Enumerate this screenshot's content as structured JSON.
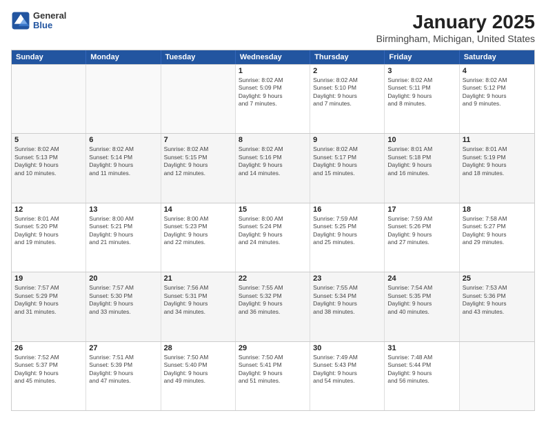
{
  "header": {
    "logo_general": "General",
    "logo_blue": "Blue",
    "month": "January 2025",
    "location": "Birmingham, Michigan, United States"
  },
  "days_of_week": [
    "Sunday",
    "Monday",
    "Tuesday",
    "Wednesday",
    "Thursday",
    "Friday",
    "Saturday"
  ],
  "weeks": [
    [
      {
        "day": "",
        "info": ""
      },
      {
        "day": "",
        "info": ""
      },
      {
        "day": "",
        "info": ""
      },
      {
        "day": "1",
        "info": "Sunrise: 8:02 AM\nSunset: 5:09 PM\nDaylight: 9 hours\nand 7 minutes."
      },
      {
        "day": "2",
        "info": "Sunrise: 8:02 AM\nSunset: 5:10 PM\nDaylight: 9 hours\nand 7 minutes."
      },
      {
        "day": "3",
        "info": "Sunrise: 8:02 AM\nSunset: 5:11 PM\nDaylight: 9 hours\nand 8 minutes."
      },
      {
        "day": "4",
        "info": "Sunrise: 8:02 AM\nSunset: 5:12 PM\nDaylight: 9 hours\nand 9 minutes."
      }
    ],
    [
      {
        "day": "5",
        "info": "Sunrise: 8:02 AM\nSunset: 5:13 PM\nDaylight: 9 hours\nand 10 minutes."
      },
      {
        "day": "6",
        "info": "Sunrise: 8:02 AM\nSunset: 5:14 PM\nDaylight: 9 hours\nand 11 minutes."
      },
      {
        "day": "7",
        "info": "Sunrise: 8:02 AM\nSunset: 5:15 PM\nDaylight: 9 hours\nand 12 minutes."
      },
      {
        "day": "8",
        "info": "Sunrise: 8:02 AM\nSunset: 5:16 PM\nDaylight: 9 hours\nand 14 minutes."
      },
      {
        "day": "9",
        "info": "Sunrise: 8:02 AM\nSunset: 5:17 PM\nDaylight: 9 hours\nand 15 minutes."
      },
      {
        "day": "10",
        "info": "Sunrise: 8:01 AM\nSunset: 5:18 PM\nDaylight: 9 hours\nand 16 minutes."
      },
      {
        "day": "11",
        "info": "Sunrise: 8:01 AM\nSunset: 5:19 PM\nDaylight: 9 hours\nand 18 minutes."
      }
    ],
    [
      {
        "day": "12",
        "info": "Sunrise: 8:01 AM\nSunset: 5:20 PM\nDaylight: 9 hours\nand 19 minutes."
      },
      {
        "day": "13",
        "info": "Sunrise: 8:00 AM\nSunset: 5:21 PM\nDaylight: 9 hours\nand 21 minutes."
      },
      {
        "day": "14",
        "info": "Sunrise: 8:00 AM\nSunset: 5:23 PM\nDaylight: 9 hours\nand 22 minutes."
      },
      {
        "day": "15",
        "info": "Sunrise: 8:00 AM\nSunset: 5:24 PM\nDaylight: 9 hours\nand 24 minutes."
      },
      {
        "day": "16",
        "info": "Sunrise: 7:59 AM\nSunset: 5:25 PM\nDaylight: 9 hours\nand 25 minutes."
      },
      {
        "day": "17",
        "info": "Sunrise: 7:59 AM\nSunset: 5:26 PM\nDaylight: 9 hours\nand 27 minutes."
      },
      {
        "day": "18",
        "info": "Sunrise: 7:58 AM\nSunset: 5:27 PM\nDaylight: 9 hours\nand 29 minutes."
      }
    ],
    [
      {
        "day": "19",
        "info": "Sunrise: 7:57 AM\nSunset: 5:29 PM\nDaylight: 9 hours\nand 31 minutes."
      },
      {
        "day": "20",
        "info": "Sunrise: 7:57 AM\nSunset: 5:30 PM\nDaylight: 9 hours\nand 33 minutes."
      },
      {
        "day": "21",
        "info": "Sunrise: 7:56 AM\nSunset: 5:31 PM\nDaylight: 9 hours\nand 34 minutes."
      },
      {
        "day": "22",
        "info": "Sunrise: 7:55 AM\nSunset: 5:32 PM\nDaylight: 9 hours\nand 36 minutes."
      },
      {
        "day": "23",
        "info": "Sunrise: 7:55 AM\nSunset: 5:34 PM\nDaylight: 9 hours\nand 38 minutes."
      },
      {
        "day": "24",
        "info": "Sunrise: 7:54 AM\nSunset: 5:35 PM\nDaylight: 9 hours\nand 40 minutes."
      },
      {
        "day": "25",
        "info": "Sunrise: 7:53 AM\nSunset: 5:36 PM\nDaylight: 9 hours\nand 43 minutes."
      }
    ],
    [
      {
        "day": "26",
        "info": "Sunrise: 7:52 AM\nSunset: 5:37 PM\nDaylight: 9 hours\nand 45 minutes."
      },
      {
        "day": "27",
        "info": "Sunrise: 7:51 AM\nSunset: 5:39 PM\nDaylight: 9 hours\nand 47 minutes."
      },
      {
        "day": "28",
        "info": "Sunrise: 7:50 AM\nSunset: 5:40 PM\nDaylight: 9 hours\nand 49 minutes."
      },
      {
        "day": "29",
        "info": "Sunrise: 7:50 AM\nSunset: 5:41 PM\nDaylight: 9 hours\nand 51 minutes."
      },
      {
        "day": "30",
        "info": "Sunrise: 7:49 AM\nSunset: 5:43 PM\nDaylight: 9 hours\nand 54 minutes."
      },
      {
        "day": "31",
        "info": "Sunrise: 7:48 AM\nSunset: 5:44 PM\nDaylight: 9 hours\nand 56 minutes."
      },
      {
        "day": "",
        "info": ""
      }
    ]
  ]
}
